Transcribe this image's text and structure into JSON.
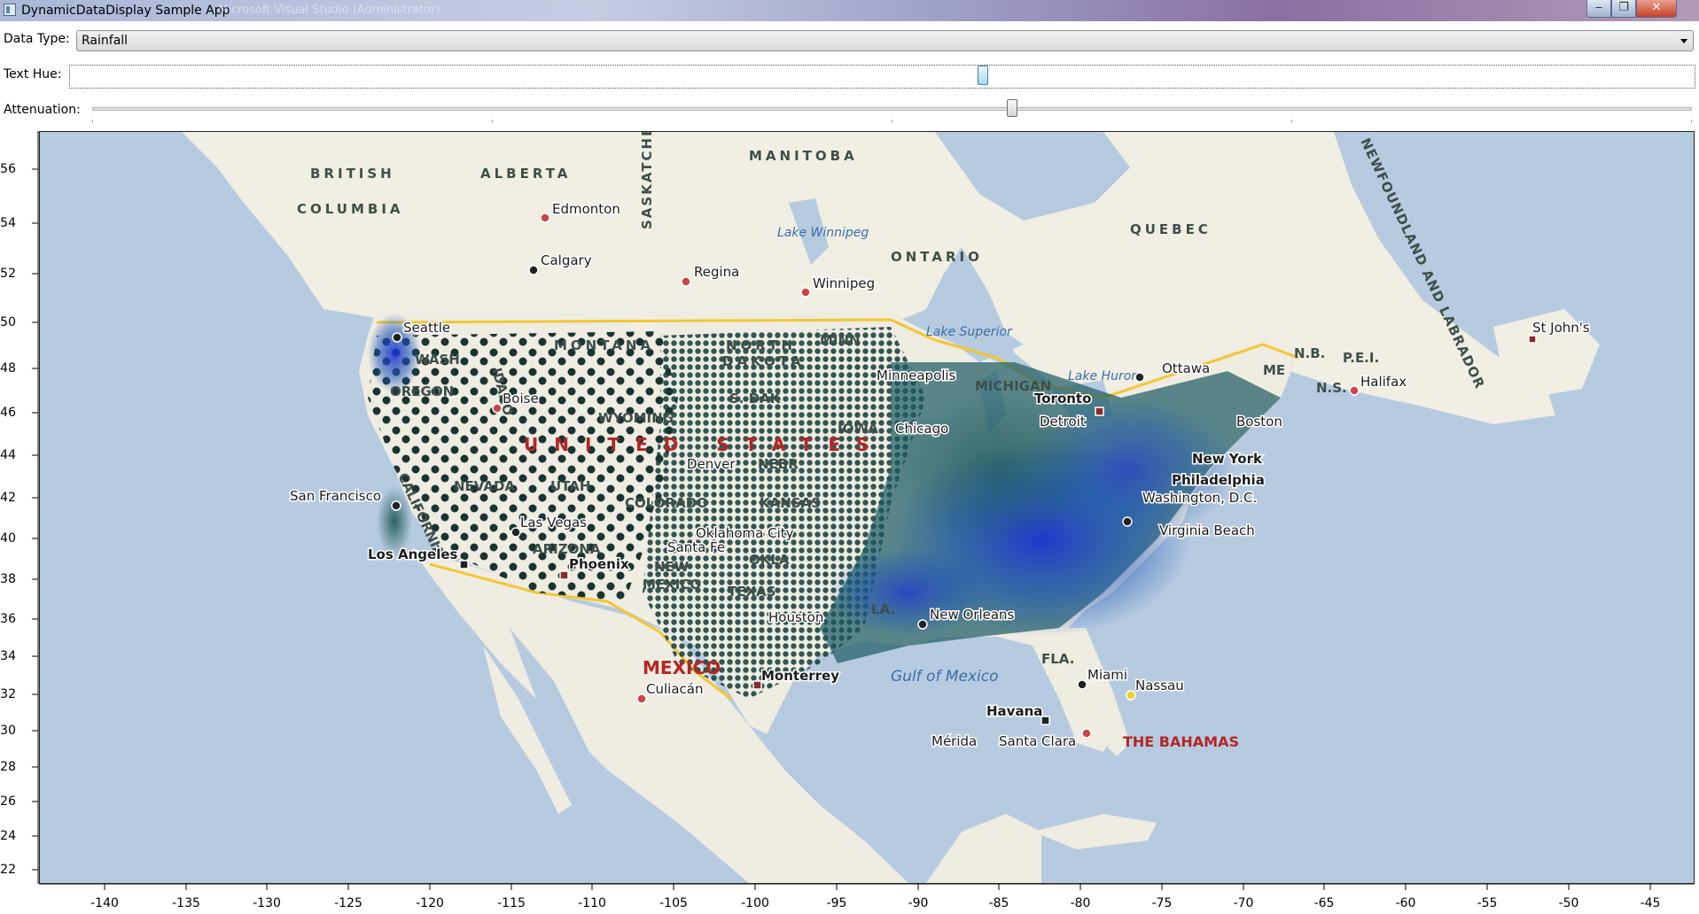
{
  "window": {
    "title": "DynamicDataDisplay Sample App",
    "background_title": "Microsoft Visual Studio (Administrator)",
    "minimize_label": "‒",
    "maximize_label": "❐",
    "close_label": "✕"
  },
  "controls": {
    "data_type_label": "Data Type:",
    "data_type_value": "Rainfall",
    "text_hue_label": "Text Hue:",
    "text_hue_level": 0.54,
    "attenuation_label": "Attenuation:",
    "attenuation_level": 0.57
  },
  "map": {
    "y_ticks": [
      "56",
      "54",
      "52",
      "50",
      "48",
      "46",
      "44",
      "42",
      "40",
      "38",
      "36",
      "34",
      "32",
      "30",
      "28",
      "26",
      "24",
      "22"
    ],
    "x_ticks": [
      "-140",
      "-135",
      "-130",
      "-125",
      "-120",
      "-115",
      "-110",
      "-105",
      "-100",
      "-95",
      "-90",
      "-85",
      "-80",
      "-75",
      "-70",
      "-65",
      "-60",
      "-55",
      "-50",
      "-45"
    ],
    "regions": [
      "BRITISH",
      "COLUMBIA",
      "ALBERTA",
      "SASKATCHEWA",
      "MANITOBA",
      "ONTARIO",
      "QUEBEC",
      "NEWFOUNDLAND AND LABRADOR",
      "MONTANA",
      "NORTH",
      "DAKOTA",
      "MINN",
      "WASH",
      "OREGON",
      "IDAHO",
      "WYOMING",
      "S. DAK",
      "NEVADA",
      "UTAH",
      "COLORADO",
      "KANSAS",
      "ARIZONA",
      "NEW",
      "MEXICO",
      "TEXAS",
      "LA.",
      "FLA.",
      "MICHIGAN",
      "NEBR",
      "IOWA",
      "OKLA",
      "N.B.",
      "P.E.I.",
      "N.S.",
      "ME",
      "CALIFORNIA",
      "UNITED STATES"
    ],
    "country_mexico": "MEXICO",
    "bahamas": "THE BAHAMAS",
    "water_labels": [
      "Lake Winnipeg",
      "Lake Superior",
      "Lake Huron",
      "Gulf of Mexico"
    ],
    "cities": [
      "Edmonton",
      "Calgary",
      "Regina",
      "Winnipeg",
      "Seattle",
      "Boise",
      "San Francisco",
      "Las Vegas",
      "Los Angeles",
      "Phoenix",
      "Denver",
      "Oklahoma City",
      "Santa Fe",
      "Minneapolis",
      "Chicago",
      "Detroit",
      "Toronto",
      "Ottawa",
      "Boston",
      "New York",
      "Philadelphia",
      "Washington, D.C.",
      "Virginia Beach",
      "New Orleans",
      "Houston",
      "Monterrey",
      "Culiacán",
      "Miami",
      "Nassau",
      "Havana",
      "Mérida",
      "Santa Clara",
      "Halifax",
      "St John's"
    ],
    "legend_colors": {
      "water": "#b7cbe0",
      "land": "#efece2",
      "dry_station": "#0e2a28",
      "wet_station": "#1a4fd0"
    }
  }
}
